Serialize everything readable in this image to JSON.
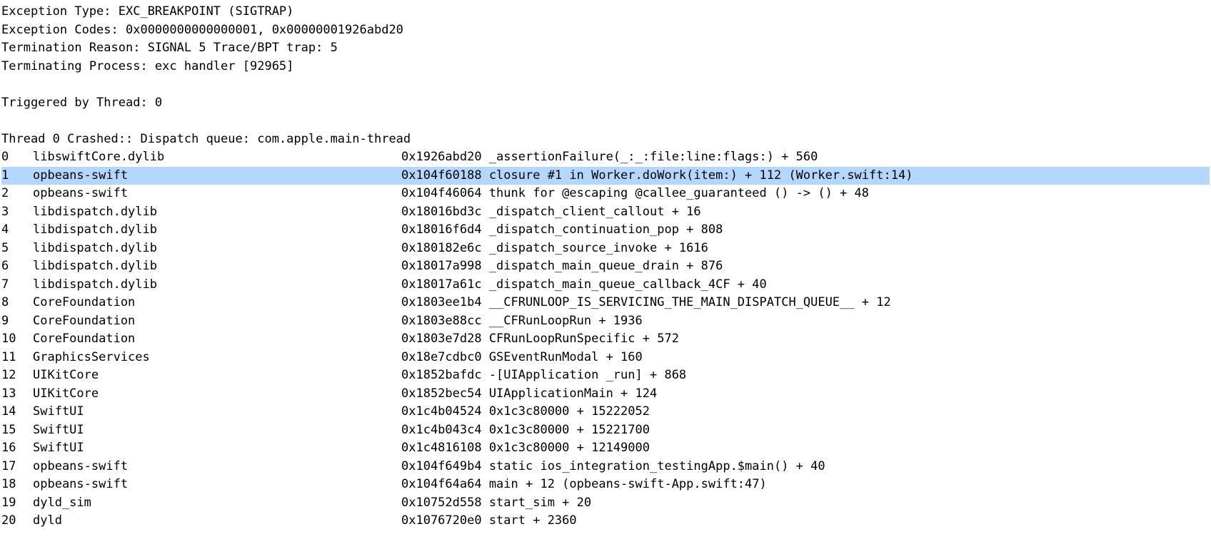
{
  "header": [
    "Exception Type:  EXC_BREAKPOINT (SIGTRAP)",
    "Exception Codes: 0x0000000000000001, 0x00000001926abd20",
    "Termination Reason: SIGNAL 5 Trace/BPT trap: 5",
    "Terminating Process: exc handler [92965]"
  ],
  "triggered": "Triggered by Thread:  0",
  "threadTitle": "Thread 0 Crashed::  Dispatch queue: com.apple.main-thread",
  "frames": [
    {
      "idx": 0,
      "module": "libswiftCore.dylib",
      "tail": "0x1926abd20 _assertionFailure(_:_:file:line:flags:) + 560",
      "highlight": false
    },
    {
      "idx": 1,
      "module": "opbeans-swift",
      "tail": "0x104f60188 closure #1 in Worker.doWork(item:) + 112 (Worker.swift:14)",
      "highlight": true
    },
    {
      "idx": 2,
      "module": "opbeans-swift",
      "tail": "0x104f46064 thunk for @escaping @callee_guaranteed () -> () + 48",
      "highlight": false
    },
    {
      "idx": 3,
      "module": "libdispatch.dylib",
      "tail": "0x18016bd3c _dispatch_client_callout + 16",
      "highlight": false
    },
    {
      "idx": 4,
      "module": "libdispatch.dylib",
      "tail": "0x18016f6d4 _dispatch_continuation_pop + 808",
      "highlight": false
    },
    {
      "idx": 5,
      "module": "libdispatch.dylib",
      "tail": "0x180182e6c _dispatch_source_invoke + 1616",
      "highlight": false
    },
    {
      "idx": 6,
      "module": "libdispatch.dylib",
      "tail": "0x18017a998 _dispatch_main_queue_drain + 876",
      "highlight": false
    },
    {
      "idx": 7,
      "module": "libdispatch.dylib",
      "tail": "0x18017a61c _dispatch_main_queue_callback_4CF + 40",
      "highlight": false
    },
    {
      "idx": 8,
      "module": "CoreFoundation",
      "tail": "0x1803ee1b4 __CFRUNLOOP_IS_SERVICING_THE_MAIN_DISPATCH_QUEUE__ + 12",
      "highlight": false
    },
    {
      "idx": 9,
      "module": "CoreFoundation",
      "tail": "0x1803e88cc __CFRunLoopRun + 1936",
      "highlight": false
    },
    {
      "idx": 10,
      "module": "CoreFoundation",
      "tail": "0x1803e7d28 CFRunLoopRunSpecific + 572",
      "highlight": false
    },
    {
      "idx": 11,
      "module": "GraphicsServices",
      "tail": "0x18e7cdbc0 GSEventRunModal + 160",
      "highlight": false
    },
    {
      "idx": 12,
      "module": "UIKitCore",
      "tail": "0x1852bafdc -[UIApplication _run] + 868",
      "highlight": false
    },
    {
      "idx": 13,
      "module": "UIKitCore",
      "tail": "0x1852bec54 UIApplicationMain + 124",
      "highlight": false
    },
    {
      "idx": 14,
      "module": "SwiftUI",
      "tail": "0x1c4b04524 0x1c3c80000 + 15222052",
      "highlight": false
    },
    {
      "idx": 15,
      "module": "SwiftUI",
      "tail": "0x1c4b043c4 0x1c3c80000 + 15221700",
      "highlight": false
    },
    {
      "idx": 16,
      "module": "SwiftUI",
      "tail": "0x1c4816108 0x1c3c80000 + 12149000",
      "highlight": false
    },
    {
      "idx": 17,
      "module": "opbeans-swift",
      "tail": "0x104f649b4 static ios_integration_testingApp.$main() + 40",
      "highlight": false
    },
    {
      "idx": 18,
      "module": "opbeans-swift",
      "tail": "0x104f64a64 main + 12 (opbeans-swift-App.swift:47)",
      "highlight": false
    },
    {
      "idx": 19,
      "module": "dyld_sim",
      "tail": "0x10752d558 start_sim + 20",
      "highlight": false
    },
    {
      "idx": 20,
      "module": "dyld",
      "tail": "0x1076720e0 start + 2360",
      "highlight": false
    }
  ]
}
